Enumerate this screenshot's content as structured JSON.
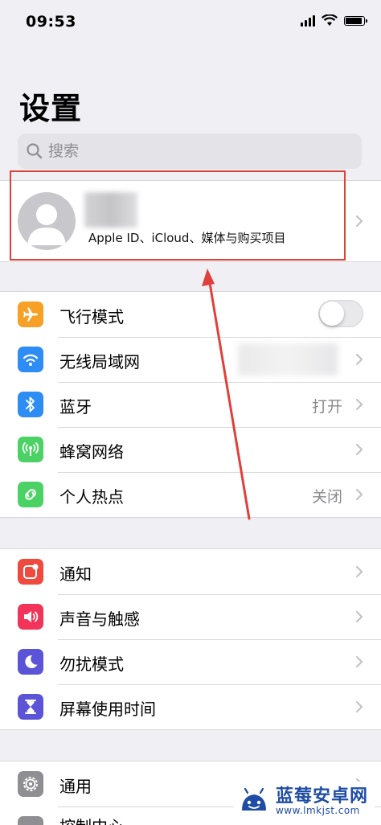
{
  "status_bar": {
    "time": "09:53"
  },
  "title": "设置",
  "search": {
    "placeholder": "搜索"
  },
  "profile": {
    "subtitle": "Apple ID、iCloud、媒体与购买项目"
  },
  "groups": [
    {
      "rows": [
        {
          "label": "飞行模式",
          "icon": "airplane-icon",
          "color": "#f7a026",
          "control": "toggle",
          "toggle_on": false
        },
        {
          "label": "无线局域网",
          "icon": "wifi-icon",
          "color": "#2e8cf5",
          "value": ""
        },
        {
          "label": "蓝牙",
          "icon": "bluetooth-icon",
          "color": "#2e8cf5",
          "value": "打开"
        },
        {
          "label": "蜂窝网络",
          "icon": "cellular-icon",
          "color": "#4cd264",
          "value": ""
        },
        {
          "label": "个人热点",
          "icon": "hotspot-icon",
          "color": "#4cd264",
          "value": "关闭"
        }
      ]
    },
    {
      "rows": [
        {
          "label": "通知",
          "icon": "notification-icon",
          "color": "#f04a3f"
        },
        {
          "label": "声音与触感",
          "icon": "sound-icon",
          "color": "#f2335a"
        },
        {
          "label": "勿扰模式",
          "icon": "moon-icon",
          "color": "#5b54d6"
        },
        {
          "label": "屏幕使用时间",
          "icon": "hourglass-icon",
          "color": "#5b54d6"
        }
      ]
    },
    {
      "rows": [
        {
          "label": "通用",
          "icon": "gear-icon",
          "color": "#8e8e93"
        }
      ]
    }
  ],
  "cut_row_label": "控制中心",
  "watermark": {
    "title": "蓝莓安卓网",
    "url": "www.lmkjst.com"
  },
  "colors": {
    "annotation": "#e0403a",
    "chevron": "#c4c4c7"
  }
}
